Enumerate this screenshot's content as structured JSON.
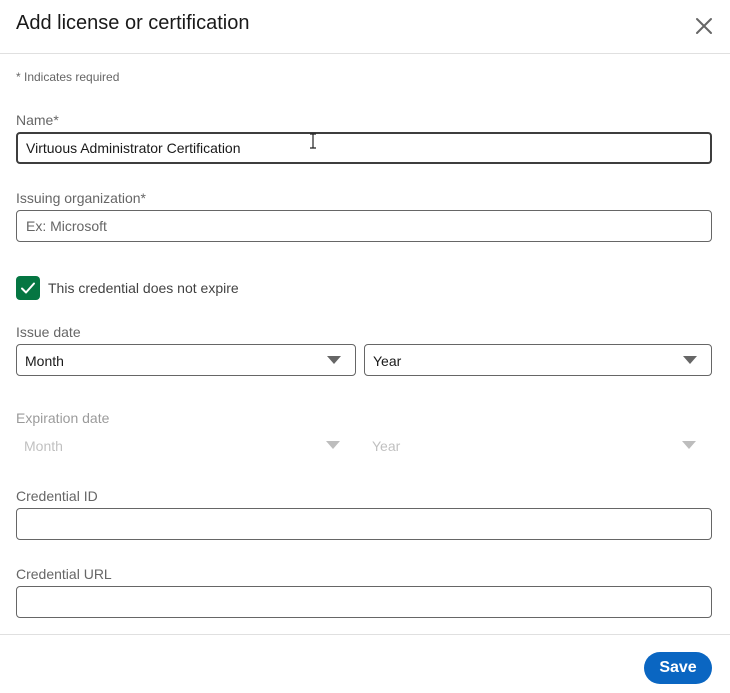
{
  "dialog": {
    "title": "Add license or certification",
    "close_icon": "close-icon"
  },
  "form": {
    "required_note": "* Indicates required",
    "name": {
      "label": "Name*",
      "value": "Virtuous Administrator Certification",
      "placeholder": ""
    },
    "issuing_org": {
      "label": "Issuing organization*",
      "value": "",
      "placeholder": "Ex: Microsoft"
    },
    "no_expire": {
      "label": "This credential does not expire",
      "checked": true,
      "check_icon": "checkmark-icon"
    },
    "issue_date": {
      "label": "Issue date",
      "month": "Month",
      "year": "Year"
    },
    "expiration_date": {
      "label": "Expiration date",
      "month": "Month",
      "year": "Year",
      "disabled": true
    },
    "credential_id": {
      "label": "Credential ID",
      "value": ""
    },
    "credential_url": {
      "label": "Credential URL",
      "value": ""
    }
  },
  "footer": {
    "save_label": "Save"
  },
  "colors": {
    "primary": "#0a66c2",
    "checkbox": "#057642"
  }
}
